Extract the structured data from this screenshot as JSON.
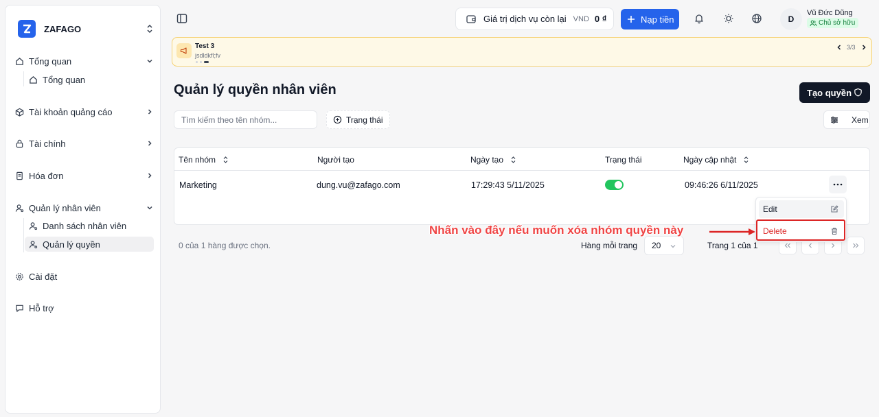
{
  "brand": {
    "name": "ZAFAGO"
  },
  "sidebar": {
    "groups": [
      {
        "label": "Tổng quan",
        "sub": [
          {
            "label": "Tổng quan"
          }
        ]
      },
      {
        "label": "Tài khoản quảng cáo"
      },
      {
        "label": "Tài chính"
      },
      {
        "label": "Hóa đơn"
      },
      {
        "label": "Quản lý nhân viên",
        "sub": [
          {
            "label": "Danh sách nhân viên"
          },
          {
            "label": "Quản lý quyền"
          }
        ]
      },
      {
        "label": "Cài đặt"
      },
      {
        "label": "Hỗ trợ"
      }
    ],
    "active": "Quản lý quyền"
  },
  "header": {
    "wallet": {
      "label": "Giá trị dịch vụ còn lại",
      "currency": "VND",
      "amount": "0 ₫"
    },
    "topup_label": "Nạp tiền",
    "user": {
      "initial": "D",
      "name": "Vũ Đức Dũng",
      "role": "Chủ sở hữu"
    }
  },
  "banner": {
    "title": "Test 3",
    "description": "jsdldkfl;fv",
    "counter": "3/3"
  },
  "page": {
    "title": "Quản lý quyền nhân viên",
    "create_label": "Tạo quyền",
    "search_placeholder": "Tìm kiếm theo tên nhóm...",
    "status_filter": "Trạng thái",
    "view_label": "Xem"
  },
  "table": {
    "columns": [
      "Tên nhóm",
      "Người tạo",
      "Ngày tạo",
      "Trạng thái",
      "Ngày cập nhật"
    ],
    "rows": [
      {
        "name": "Marketing",
        "creator": "dung.vu@zafago.com",
        "created": "17:29:43 5/11/2025",
        "active": true,
        "updated": "09:46:26 6/11/2025"
      }
    ]
  },
  "row_menu": {
    "edit": "Edit",
    "delete": "Delete"
  },
  "annotation": "Nhấn vào đây nếu muốn xóa nhóm quyền này",
  "footer": {
    "selection": "0 của 1 hàng được chọn.",
    "rows_per_page_label": "Hàng mỗi trang",
    "rows_per_page": "20",
    "page_info": "Trang 1 của 1"
  },
  "colors": {
    "primary": "#2563eb",
    "danger": "#dc2626",
    "success": "#22c55e",
    "banner_bg": "#fef9e7"
  }
}
